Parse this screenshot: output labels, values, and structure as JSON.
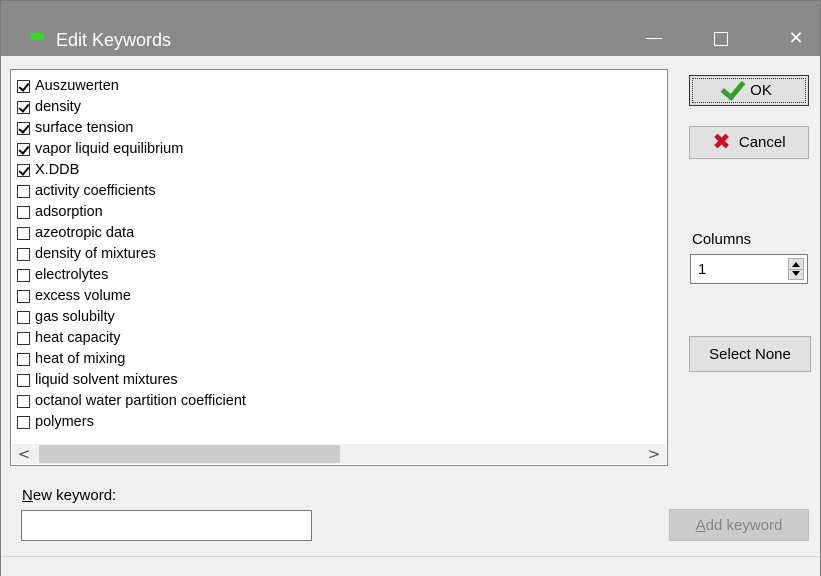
{
  "window": {
    "title": "Edit Keywords",
    "minimize_label": "—",
    "close_label": "✕"
  },
  "keywords": [
    {
      "label": "Auszuwerten",
      "checked": true
    },
    {
      "label": "density",
      "checked": true
    },
    {
      "label": "surface tension",
      "checked": true
    },
    {
      "label": "vapor liquid equilibrium",
      "checked": true
    },
    {
      "label": "X.DDB",
      "checked": true
    },
    {
      "label": "activity coefficients",
      "checked": false
    },
    {
      "label": "adsorption",
      "checked": false
    },
    {
      "label": "azeotropic data",
      "checked": false
    },
    {
      "label": "density of mixtures",
      "checked": false
    },
    {
      "label": "electrolytes",
      "checked": false
    },
    {
      "label": "excess volume",
      "checked": false
    },
    {
      "label": "gas solubilty",
      "checked": false
    },
    {
      "label": "heat capacity",
      "checked": false
    },
    {
      "label": "heat of mixing",
      "checked": false
    },
    {
      "label": "liquid solvent mixtures",
      "checked": false
    },
    {
      "label": "octanol water partition coefficient",
      "checked": false
    },
    {
      "label": "polymers",
      "checked": false
    }
  ],
  "scrollbar": {
    "left_arrow": "<",
    "right_arrow": ">"
  },
  "buttons": {
    "ok": "OK",
    "cancel": "Cancel",
    "select_none": "Select None",
    "add_keyword_prefix": "A",
    "add_keyword_rest": "dd keyword"
  },
  "columns": {
    "label": "Columns",
    "value": "1"
  },
  "new_keyword": {
    "label_prefix": "N",
    "label_rest": "ew keyword:",
    "value": ""
  },
  "colors": {
    "titlebar": "#8a8a8a",
    "ok_check": "#33a02c",
    "cancel_x": "#c4141f",
    "title_icon": "#33dd22"
  },
  "icons": {
    "app": "app-icon",
    "ok": "checkmark-icon",
    "cancel": "x-icon"
  }
}
